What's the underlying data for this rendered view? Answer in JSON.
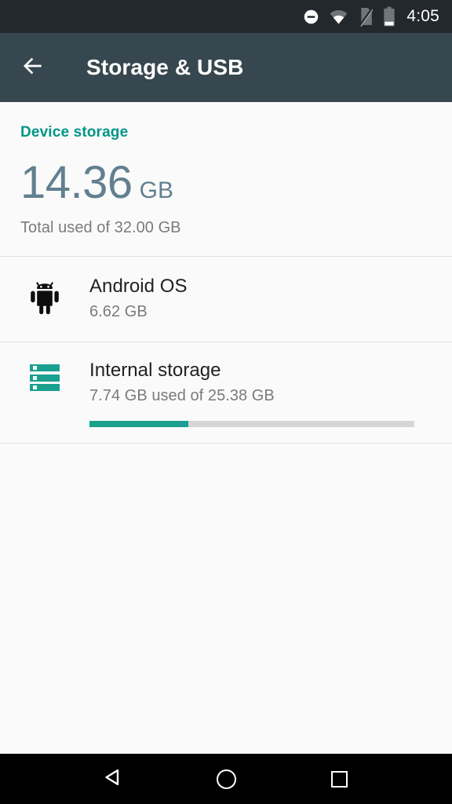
{
  "status_bar": {
    "time": "4:05",
    "icons": [
      {
        "name": "do-not-disturb-icon",
        "label": "Do not disturb"
      },
      {
        "name": "wifi-icon",
        "label": "Wi-Fi connected"
      },
      {
        "name": "no-sim-icon",
        "label": "No SIM card"
      },
      {
        "name": "battery-icon",
        "label": "Battery low"
      }
    ]
  },
  "app_bar": {
    "back_label": "Navigate up",
    "title": "Storage & USB"
  },
  "summary": {
    "section_label": "Device storage",
    "used_value": "14.36",
    "used_unit": "GB",
    "subtitle": "Total used of 32.00 GB"
  },
  "rows": [
    {
      "icon": "android-robot-icon",
      "title": "Android OS",
      "subtitle": "6.62 GB",
      "has_progress": false
    },
    {
      "icon": "internal-storage-icon",
      "title": "Internal storage",
      "subtitle": "7.74 GB used of 25.38 GB",
      "has_progress": true,
      "progress_percent": 30.5
    }
  ],
  "nav_bar": {
    "back_label": "Back",
    "home_label": "Home",
    "recents_label": "Recent apps"
  },
  "colors": {
    "accent_teal": "#009688",
    "progress_teal": "#1aa08f",
    "app_bar": "#37474f",
    "status_bar": "#23282d",
    "big_number": "#62808f",
    "background": "#fafafa"
  }
}
